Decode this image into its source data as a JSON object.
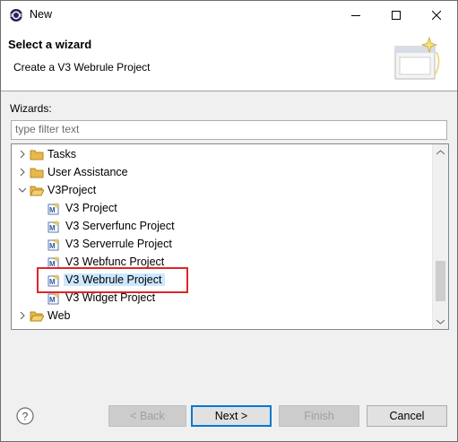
{
  "window": {
    "title": "New"
  },
  "header": {
    "title": "Select a wizard",
    "description": "Create a V3 Webrule Project"
  },
  "wizards_label": "Wizards:",
  "filter": {
    "placeholder": "type filter text",
    "value": ""
  },
  "tree": {
    "items": [
      {
        "label": "Tasks",
        "kind": "folder",
        "expanded": false
      },
      {
        "label": "User Assistance",
        "kind": "folder",
        "expanded": false
      },
      {
        "label": "V3Project",
        "kind": "folder",
        "expanded": true
      },
      {
        "label": "V3 Project",
        "kind": "project"
      },
      {
        "label": "V3 Serverfunc Project",
        "kind": "project"
      },
      {
        "label": "V3 Serverrule Project",
        "kind": "project"
      },
      {
        "label": "V3 Webfunc Project",
        "kind": "project"
      },
      {
        "label": "V3 Webrule Project",
        "kind": "project",
        "selected": true
      },
      {
        "label": "V3 Widget Project",
        "kind": "project"
      },
      {
        "label": "Web",
        "kind": "folder",
        "expanded": false
      }
    ]
  },
  "buttons": {
    "back": "< Back",
    "next": "Next >",
    "finish": "Finish",
    "cancel": "Cancel"
  },
  "colors": {
    "selection": "#cce8ff",
    "highlight_box": "#e0252b",
    "folder": "#e8b84a"
  }
}
